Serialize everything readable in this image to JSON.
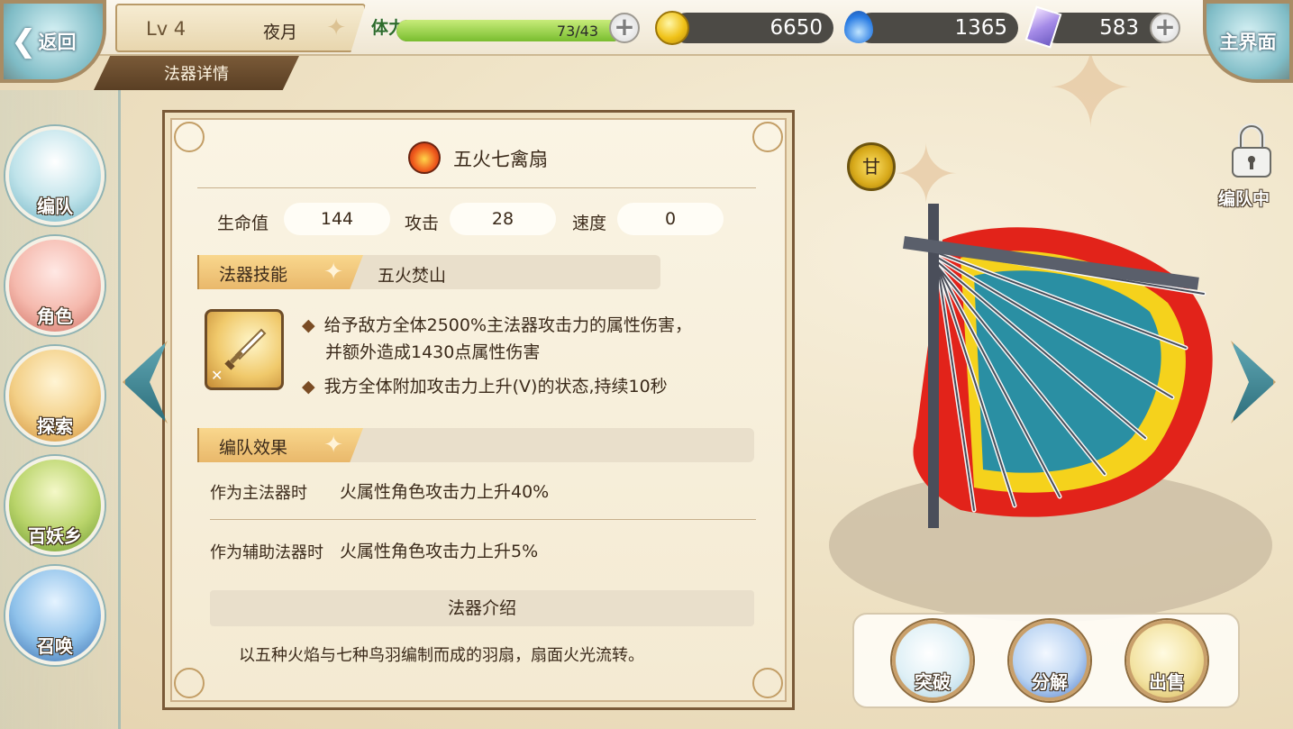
{
  "header": {
    "back_label": "返回",
    "level": "Lv 4",
    "player_name": "夜月",
    "sub_tab": "法器详情",
    "home_label": "主界面"
  },
  "resources": {
    "stamina_label": "体力",
    "stamina_value": "73/43",
    "stamina_fill_fraction": 1.0,
    "gold": "6650",
    "soul": "1365",
    "gem": "583"
  },
  "sidebar": {
    "items": [
      {
        "label": "编队"
      },
      {
        "label": "角色"
      },
      {
        "label": "探索"
      },
      {
        "label": "百妖乡"
      },
      {
        "label": "召唤"
      }
    ]
  },
  "item": {
    "name": "五火七禽扇",
    "stats": [
      {
        "label": "生命值",
        "value": "144"
      },
      {
        "label": "攻击",
        "value": "28"
      },
      {
        "label": "速度",
        "value": "0"
      }
    ],
    "skill_section": "法器技能",
    "skill_name": "五火焚山",
    "skill_lines": [
      "给予敌方全体2500%主法器攻击力的属性伤害，",
      "并额外造成1430点属性伤害",
      "我方全体附加攻击力上升(V)的状态,持续10秒"
    ],
    "team_section": "编队效果",
    "team_effects": [
      {
        "condition": "作为主法器时",
        "effect": "火属性角色攻击力上升40%"
      },
      {
        "condition": "作为辅助法器时",
        "effect": "火属性角色攻击力上升5%"
      }
    ],
    "intro_header": "法器介绍",
    "intro_text": "以五种火焰与七种鸟羽编制而成的羽扇，扇面火光流转。"
  },
  "display": {
    "rarity_glyph": "甘",
    "lock_status": "编队中"
  },
  "actions": [
    {
      "label": "突破"
    },
    {
      "label": "分解"
    },
    {
      "label": "出售"
    }
  ],
  "colors": {
    "panel_border": "#7a5a38",
    "section_tag": "#f0c47a",
    "stamina_fill": "#8fcc3a",
    "accent_teal": "#4f98a6"
  }
}
